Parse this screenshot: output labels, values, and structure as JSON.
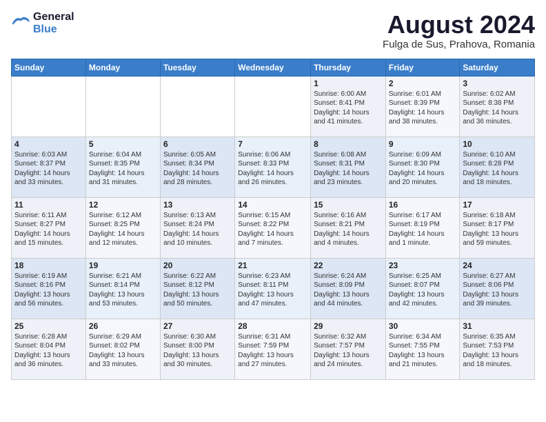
{
  "header": {
    "logo_general": "General",
    "logo_blue": "Blue",
    "month_year": "August 2024",
    "location": "Fulga de Sus, Prahova, Romania"
  },
  "weekdays": [
    "Sunday",
    "Monday",
    "Tuesday",
    "Wednesday",
    "Thursday",
    "Friday",
    "Saturday"
  ],
  "weeks": [
    [
      {
        "day": "",
        "content": ""
      },
      {
        "day": "",
        "content": ""
      },
      {
        "day": "",
        "content": ""
      },
      {
        "day": "",
        "content": ""
      },
      {
        "day": "1",
        "content": "Sunrise: 6:00 AM\nSunset: 8:41 PM\nDaylight: 14 hours\nand 41 minutes."
      },
      {
        "day": "2",
        "content": "Sunrise: 6:01 AM\nSunset: 8:39 PM\nDaylight: 14 hours\nand 38 minutes."
      },
      {
        "day": "3",
        "content": "Sunrise: 6:02 AM\nSunset: 8:38 PM\nDaylight: 14 hours\nand 36 minutes."
      }
    ],
    [
      {
        "day": "4",
        "content": "Sunrise: 6:03 AM\nSunset: 8:37 PM\nDaylight: 14 hours\nand 33 minutes."
      },
      {
        "day": "5",
        "content": "Sunrise: 6:04 AM\nSunset: 8:35 PM\nDaylight: 14 hours\nand 31 minutes."
      },
      {
        "day": "6",
        "content": "Sunrise: 6:05 AM\nSunset: 8:34 PM\nDaylight: 14 hours\nand 28 minutes."
      },
      {
        "day": "7",
        "content": "Sunrise: 6:06 AM\nSunset: 8:33 PM\nDaylight: 14 hours\nand 26 minutes."
      },
      {
        "day": "8",
        "content": "Sunrise: 6:08 AM\nSunset: 8:31 PM\nDaylight: 14 hours\nand 23 minutes."
      },
      {
        "day": "9",
        "content": "Sunrise: 6:09 AM\nSunset: 8:30 PM\nDaylight: 14 hours\nand 20 minutes."
      },
      {
        "day": "10",
        "content": "Sunrise: 6:10 AM\nSunset: 8:28 PM\nDaylight: 14 hours\nand 18 minutes."
      }
    ],
    [
      {
        "day": "11",
        "content": "Sunrise: 6:11 AM\nSunset: 8:27 PM\nDaylight: 14 hours\nand 15 minutes."
      },
      {
        "day": "12",
        "content": "Sunrise: 6:12 AM\nSunset: 8:25 PM\nDaylight: 14 hours\nand 12 minutes."
      },
      {
        "day": "13",
        "content": "Sunrise: 6:13 AM\nSunset: 8:24 PM\nDaylight: 14 hours\nand 10 minutes."
      },
      {
        "day": "14",
        "content": "Sunrise: 6:15 AM\nSunset: 8:22 PM\nDaylight: 14 hours\nand 7 minutes."
      },
      {
        "day": "15",
        "content": "Sunrise: 6:16 AM\nSunset: 8:21 PM\nDaylight: 14 hours\nand 4 minutes."
      },
      {
        "day": "16",
        "content": "Sunrise: 6:17 AM\nSunset: 8:19 PM\nDaylight: 14 hours\nand 1 minute."
      },
      {
        "day": "17",
        "content": "Sunrise: 6:18 AM\nSunset: 8:17 PM\nDaylight: 13 hours\nand 59 minutes."
      }
    ],
    [
      {
        "day": "18",
        "content": "Sunrise: 6:19 AM\nSunset: 8:16 PM\nDaylight: 13 hours\nand 56 minutes."
      },
      {
        "day": "19",
        "content": "Sunrise: 6:21 AM\nSunset: 8:14 PM\nDaylight: 13 hours\nand 53 minutes."
      },
      {
        "day": "20",
        "content": "Sunrise: 6:22 AM\nSunset: 8:12 PM\nDaylight: 13 hours\nand 50 minutes."
      },
      {
        "day": "21",
        "content": "Sunrise: 6:23 AM\nSunset: 8:11 PM\nDaylight: 13 hours\nand 47 minutes."
      },
      {
        "day": "22",
        "content": "Sunrise: 6:24 AM\nSunset: 8:09 PM\nDaylight: 13 hours\nand 44 minutes."
      },
      {
        "day": "23",
        "content": "Sunrise: 6:25 AM\nSunset: 8:07 PM\nDaylight: 13 hours\nand 42 minutes."
      },
      {
        "day": "24",
        "content": "Sunrise: 6:27 AM\nSunset: 8:06 PM\nDaylight: 13 hours\nand 39 minutes."
      }
    ],
    [
      {
        "day": "25",
        "content": "Sunrise: 6:28 AM\nSunset: 8:04 PM\nDaylight: 13 hours\nand 36 minutes."
      },
      {
        "day": "26",
        "content": "Sunrise: 6:29 AM\nSunset: 8:02 PM\nDaylight: 13 hours\nand 33 minutes."
      },
      {
        "day": "27",
        "content": "Sunrise: 6:30 AM\nSunset: 8:00 PM\nDaylight: 13 hours\nand 30 minutes."
      },
      {
        "day": "28",
        "content": "Sunrise: 6:31 AM\nSunset: 7:59 PM\nDaylight: 13 hours\nand 27 minutes."
      },
      {
        "day": "29",
        "content": "Sunrise: 6:32 AM\nSunset: 7:57 PM\nDaylight: 13 hours\nand 24 minutes."
      },
      {
        "day": "30",
        "content": "Sunrise: 6:34 AM\nSunset: 7:55 PM\nDaylight: 13 hours\nand 21 minutes."
      },
      {
        "day": "31",
        "content": "Sunrise: 6:35 AM\nSunset: 7:53 PM\nDaylight: 13 hours\nand 18 minutes."
      }
    ]
  ]
}
